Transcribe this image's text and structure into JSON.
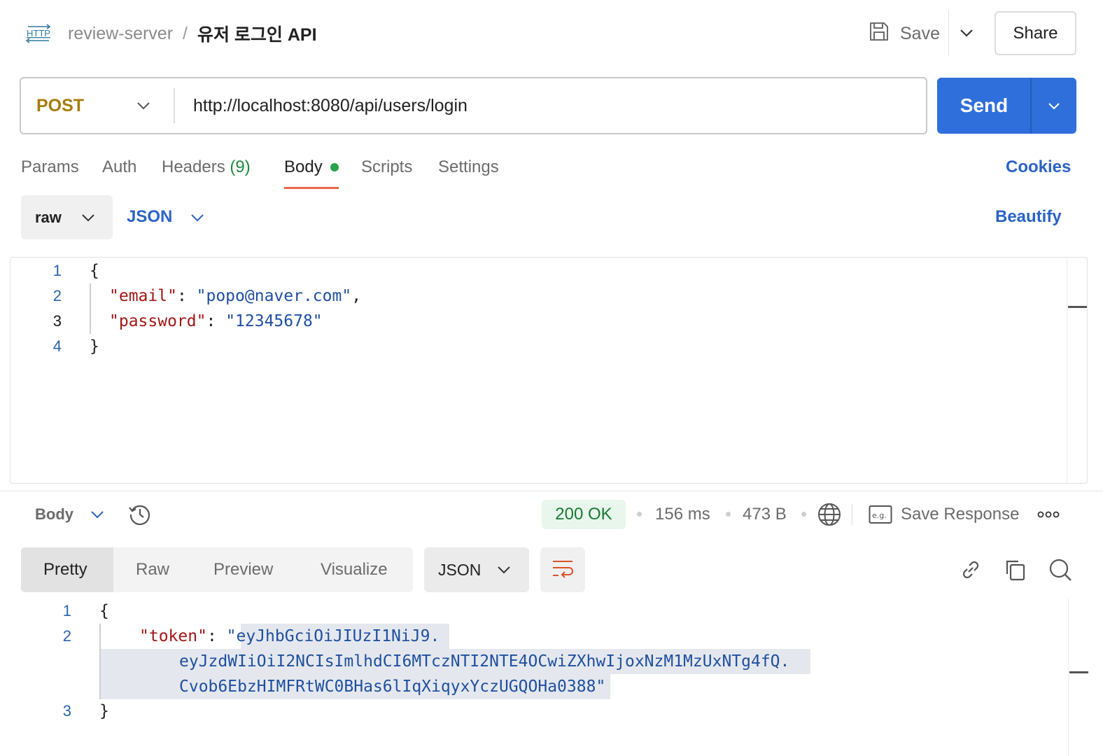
{
  "header": {
    "protocol_icon": "http-icon",
    "collection": "review-server",
    "separator": "/",
    "request_name": "유저 로그인 API",
    "save_label": "Save",
    "share_label": "Share"
  },
  "request": {
    "method": "POST",
    "url": "http://localhost:8080/api/users/login",
    "send_label": "Send"
  },
  "tabs": {
    "params": "Params",
    "auth": "Auth",
    "headers": "Headers",
    "headers_count": "(9)",
    "body": "Body",
    "scripts": "Scripts",
    "settings": "Settings",
    "cookies": "Cookies"
  },
  "body_mode": {
    "mode": "raw",
    "language": "JSON",
    "beautify": "Beautify"
  },
  "request_body": {
    "line_numbers": [
      "1",
      "2",
      "3",
      "4"
    ],
    "open_brace": "{",
    "email_key": "\"email\"",
    "email_value": "\"popo@naver.com\"",
    "password_key": "\"password\"",
    "password_value": "\"12345678\"",
    "close_brace": "}"
  },
  "response": {
    "view_label": "Body",
    "status": "200 OK",
    "time": "156 ms",
    "size": "473 B",
    "save_response": "Save Response",
    "views": [
      "Pretty",
      "Raw",
      "Preview",
      "Visualize"
    ],
    "active_view": "Pretty",
    "format": "JSON",
    "line_numbers": [
      "1",
      "2",
      "3"
    ],
    "open_brace": "{",
    "token_key": "\"token\"",
    "token_line_1": "eyJhbGciOiJIUzI1NiJ9.",
    "token_line_2": "eyJzdWIiOiI2NCIsImlhdCI6MTczNTI2NTE4OCwiZXhwIjoxNzM1MzUxNTg4fQ.",
    "token_line_3": "Cvob6EbzHIMFRtWC0BHas6lIqXiqyxYczUGQOHa0388",
    "close_brace": "}"
  },
  "colors": {
    "method": "#a67c0f",
    "send": "#2f6fdc",
    "link": "#2a63c7",
    "status_ok": "#1b7a35",
    "json_key": "#a31515",
    "json_string": "#1f4fa0",
    "tab_underline": "#e8674a"
  }
}
